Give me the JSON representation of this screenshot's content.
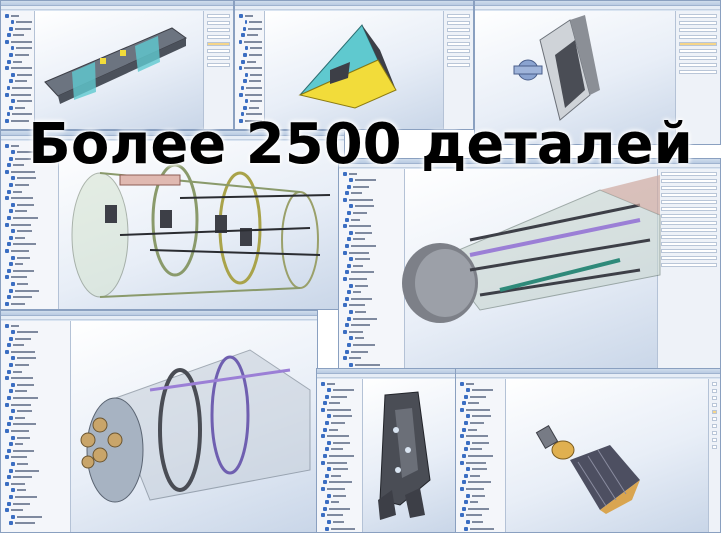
{
  "headline": "Более 2500 деталей",
  "colors": {
    "headline": "#000000",
    "ui_chrome": "#d9e4f1",
    "tree_icon": "#3b6ec2",
    "viewport_bg": "#e8eef7",
    "highlight_field": "#f5d58a",
    "part_teal": "#5fc9cf",
    "part_yellow": "#f2dc3a",
    "part_purple": "#9b7fd6",
    "part_dark": "#3d3f47"
  },
  "windows": [
    {
      "name": "cad-window-beam-assembly",
      "model": "beam-assembly-model"
    },
    {
      "name": "cad-window-wedge-bracket",
      "model": "wedge-bracket-model"
    },
    {
      "name": "cad-window-hinge-bracket",
      "model": "hinge-bracket-model"
    },
    {
      "name": "cad-window-frame-assembly",
      "model": "frame-assembly-model"
    },
    {
      "name": "cad-window-nose-section",
      "model": "nose-section-model"
    },
    {
      "name": "cad-window-engine-module",
      "model": "engine-module-model"
    },
    {
      "name": "cad-window-truss-part",
      "model": "truss-part-model"
    },
    {
      "name": "cad-window-nozzle",
      "model": "nozzle-model"
    }
  ]
}
